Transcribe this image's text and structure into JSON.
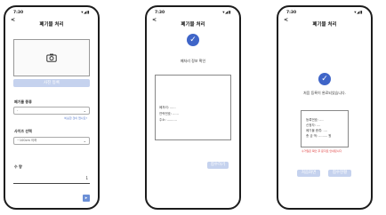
{
  "screens": {
    "input": {
      "status_time": "7:30",
      "status_sys": "▾◢▮",
      "back": "<",
      "title": "폐기물 처리",
      "photo_button": "사진 등록",
      "category_label": "폐기물 종류",
      "category_value": "-",
      "category_link": "비슷한 것이 없나요?",
      "size_label": "사이즈 선택",
      "size_value": "~100cm 이하",
      "qty_label": "수 량",
      "qty_value": "1",
      "next_icon": "▸"
    },
    "confirm": {
      "status_time": "7:30",
      "status_sys": "▾◢▮",
      "back": "<",
      "title": "폐기물 처리",
      "check_icon": "✓",
      "message": "폐처리 정보 확인",
      "info": [
        "폐처리: ......",
        "연락번호: ......",
        "주소: .........."
      ],
      "submit_button": "접수하기"
    },
    "done": {
      "status_time": "7:30",
      "status_sys": "▾◢▮",
      "back": "<",
      "title": "폐기물 처리",
      "check_icon": "✓",
      "message": "처음 등록이 완료되었습니다.",
      "info": [
        "등록번호: ....",
        "신청자: ....",
        "폐기물 종류: ....",
        "총 금 액: ......... 원"
      ],
      "notice": "수거일은 확인 후 문자로 안내됩니다",
      "home_button": "처음화면",
      "detail_button": "접수현황"
    }
  }
}
